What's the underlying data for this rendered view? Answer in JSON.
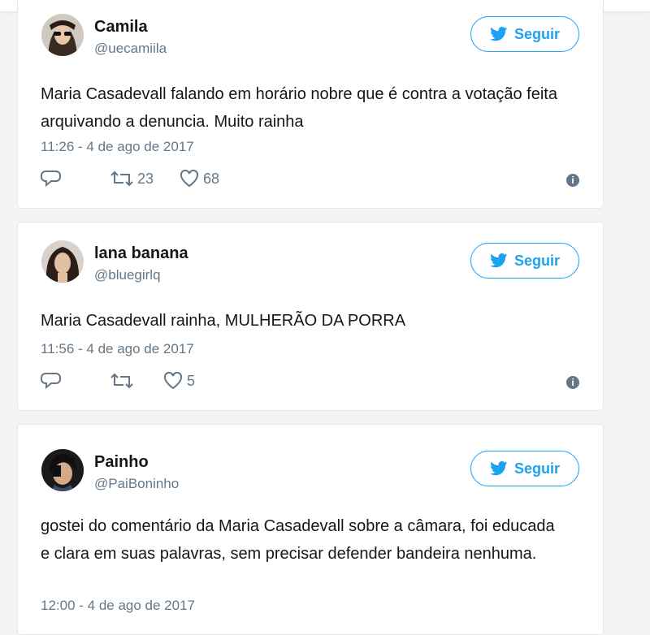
{
  "follow_label": "Seguir",
  "tweets": [
    {
      "name": "Camila",
      "handle": "@uecamiila",
      "text": "Maria Casadevall falando em horário nobre que é contra a votação feita arquivando a denuncia. Muito rainha",
      "time": "11:26 - 4 de ago de 2017",
      "retweets": "23",
      "likes": "68"
    },
    {
      "name": "lana banana",
      "handle": "@bluegirlq",
      "text": "Maria Casadevall rainha, MULHERÃO DA PORRA",
      "time": "11:56 - 4 de ago de 2017",
      "retweets": "",
      "likes": "5"
    },
    {
      "name": "Painho",
      "handle": "@PaiBoninho",
      "text": "gostei do comentário da Maria Casadevall sobre a câmara, foi educada e clara em suas palavras, sem precisar defender bandeira nenhuma.",
      "time": "12:00 - 4 de ago de 2017"
    }
  ],
  "colors": {
    "accent": "#1da1f2",
    "muted": "#657786",
    "text": "#14171a",
    "border": "#e1e8ed"
  }
}
